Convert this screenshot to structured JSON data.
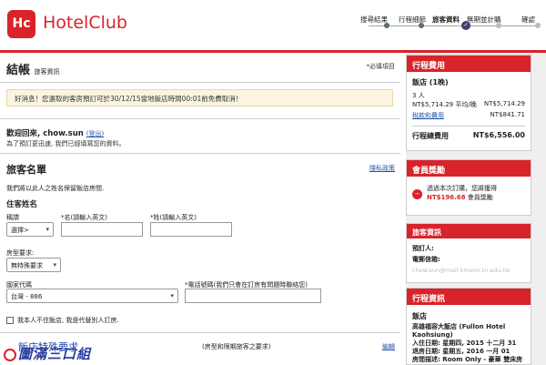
{
  "header": {
    "logo_mark": "Hc",
    "brand": "HotelClub",
    "steps": [
      "搜尋結果",
      "行程細節",
      "旅客資料",
      "無期並計購",
      "確認"
    ]
  },
  "page": {
    "title": "結帳",
    "title_sub": "旅客資訊",
    "required_note": "*必填項目",
    "notice": "好消息！您選取的客房預訂可於30/12/15當地飯店時間00:01前免費取消！"
  },
  "welcome": {
    "text": "歡迎回來, chow.sun",
    "logout": "(登出)",
    "sub": "為了預訂更迅速, 我們已經填寫您的資料。"
  },
  "guest": {
    "title": "旅客名單",
    "edit": "隱私政策",
    "desc": "我們將以此人之姓名保留飯店房間.",
    "name_heading": "住客姓名",
    "title_label": "稱謂",
    "title_value": "選擇>",
    "first_label": "*名(請輸入英文)",
    "last_label": "*姓(請輸入英文)",
    "room_req_label": "房型要求:",
    "room_req_value": "無特殊要求",
    "country_label": "國家代碼",
    "country_value": "台灣 - 886",
    "phone_label": "*電話號碼(我們只會在訂房有問題時聯絡您)",
    "not_staying": "我本人不住飯店, 我是代替別人訂房.",
    "special_title": "飯店特殊要求",
    "special_note": "(房型和限期旅客之要求)",
    "special_edit": "編輯"
  },
  "watermark": "圖滿三口組",
  "sidebar": {
    "cost": {
      "title": "行程費用",
      "hotel_label": "飯店 (1晚)",
      "persons": "3 人",
      "avg": "NT$5,714.29 平均/晚",
      "avg_total": "NT$5,714.29",
      "tax_label": "稅款和費用",
      "tax_value": "NT$841.71",
      "total_label": "行程總費用",
      "total_value": "NT$6,556.00"
    },
    "reward": {
      "title": "會員獎勵",
      "line1": "透過本次訂購，您將獲得",
      "amount": "NT$196.68",
      "line2": "會員獎勵"
    },
    "traveler": {
      "title": "旅客資訊",
      "booker_label": "預訂人:",
      "email_label": "電郵信箱:",
      "email_value": "chow.sun@mail.kmsmr.tn.edu.tw"
    },
    "trip": {
      "title": "行程資訊",
      "hotel_label": "飯店",
      "hotel_name": "高雄福容大飯店 (Fullon Hotel Kaohsiung)",
      "checkin": "入住日期: 星期四, 2015 十二月 31",
      "checkout": "退房日期: 星期五, 2016 一月 01",
      "room": "房間描述: Room Only - 豪華 雙床房 - 城"
    }
  }
}
